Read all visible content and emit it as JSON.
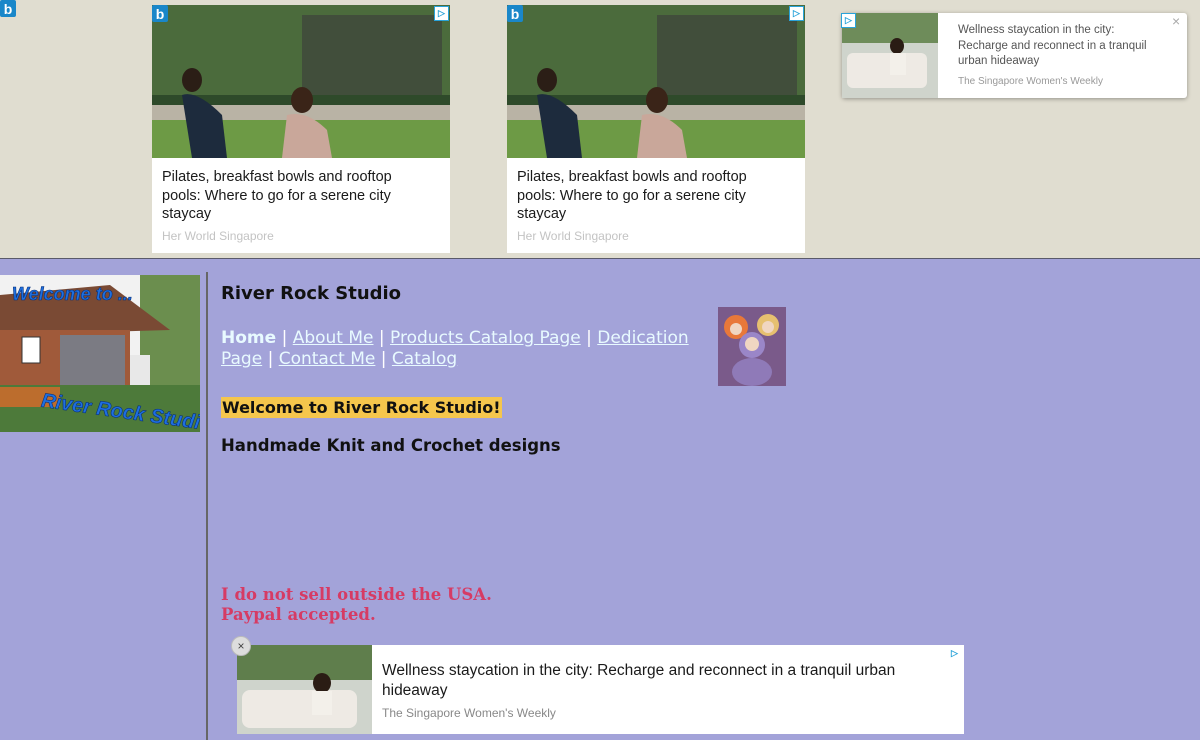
{
  "top_ads": {
    "icon": "b",
    "cards": [
      {
        "title": "Pilates, breakfast bowls and rooftop pools: Where to go for a serene city staycay",
        "source": "Her World Singapore"
      },
      {
        "title": "Pilates, breakfast bowls and rooftop pools: Where to go for a serene city staycay",
        "source": "Her World Singapore"
      }
    ],
    "side_card": {
      "title": "Wellness staycation in the city: Recharge and reconnect in a tranquil urban hideaway",
      "source": "The Singapore Women's Weekly",
      "close": "×"
    }
  },
  "sidebar": {
    "banner_top": "Welcome to ...",
    "banner_name": "River Rock Studio"
  },
  "site": {
    "title": "River Rock Studio",
    "nav": {
      "home": "Home",
      "sep": "|",
      "about": "About Me",
      "products": "Products Catalog Page",
      "dedication": "Dedication Page",
      "contact": "Contact Me",
      "catalog": "Catalog"
    },
    "welcome": "Welcome to River Rock Studio!",
    "subhead": "Handmade Knit and Crochet designs",
    "notice_line1": "I do not sell outside the USA.",
    "notice_line2": "Paypal accepted."
  },
  "bottom_ad": {
    "title": "Wellness staycation in the city: Recharge and reconnect in a tranquil urban hideaway",
    "source": "The Singapore Women's Weekly",
    "close": "×"
  },
  "colors": {
    "page_bg": "#a3a3d9",
    "top_bg": "#e0ddd0",
    "accent_link": "#e8faff",
    "highlight": "#f5c64c",
    "notice": "#d63b64"
  }
}
